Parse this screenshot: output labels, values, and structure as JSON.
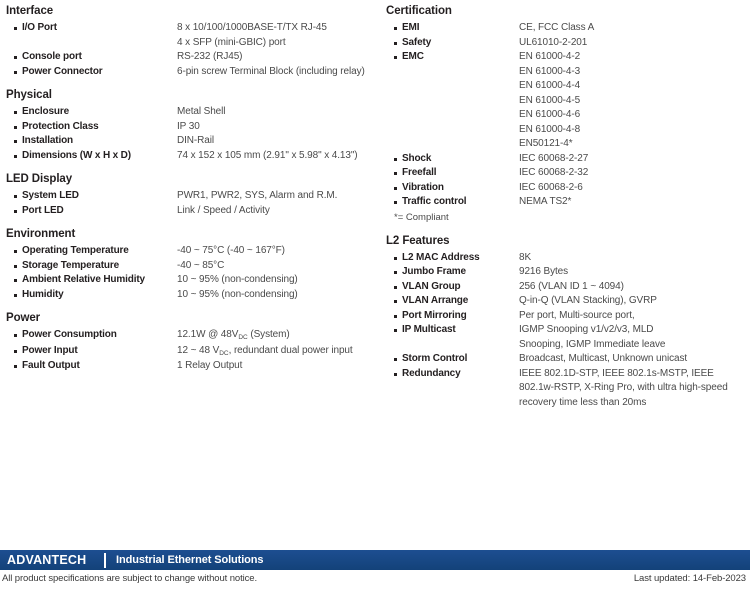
{
  "left_column": [
    {
      "title": "Interface",
      "rows": [
        {
          "label": "I/O Port",
          "values": [
            "8 x 10/100/1000BASE-T/TX RJ-45",
            "4 x SFP (mini-GBIC) port"
          ]
        },
        {
          "label": "Console port",
          "values": [
            "RS-232 (RJ45)"
          ]
        },
        {
          "label": "Power Connector",
          "values": [
            "6-pin screw Terminal Block (including relay)"
          ]
        }
      ]
    },
    {
      "title": "Physical",
      "rows": [
        {
          "label": "Enclosure",
          "values": [
            "Metal Shell"
          ]
        },
        {
          "label": "Protection Class",
          "values": [
            "IP 30"
          ]
        },
        {
          "label": "Installation",
          "values": [
            "DIN-Rail"
          ]
        },
        {
          "label": "Dimensions (W x H x D)",
          "values": [
            "74 x 152 x 105 mm (2.91\" x 5.98\" x 4.13\")"
          ]
        }
      ]
    },
    {
      "title": "LED Display",
      "rows": [
        {
          "label": "System LED",
          "values": [
            "PWR1, PWR2, SYS, Alarm and R.M."
          ]
        },
        {
          "label": "Port LED",
          "values": [
            "Link / Speed / Activity"
          ]
        }
      ]
    },
    {
      "title": "Environment",
      "rows": [
        {
          "label": "Operating Temperature",
          "values": [
            "-40 ~ 75°C (-40 ~ 167°F)"
          ]
        },
        {
          "label": "Storage Temperature",
          "values": [
            "-40 ~ 85°C"
          ]
        },
        {
          "label": "Ambient Relative Humidity",
          "values": [
            "10 ~ 95% (non-condensing)"
          ]
        },
        {
          "label": "Humidity",
          "values": [
            "10 ~ 95% (non-condensing)"
          ]
        }
      ]
    },
    {
      "title": "Power",
      "rows": [
        {
          "label": "Power Consumption",
          "values": [
            "12.1W @ 48V|DC| (System)"
          ]
        },
        {
          "label": "Power Input",
          "values": [
            "12 ~ 48 V|DC|, redundant dual power input"
          ]
        },
        {
          "label": "Fault Output",
          "values": [
            "1 Relay Output"
          ]
        }
      ]
    }
  ],
  "right_column": [
    {
      "title": "Certification",
      "rows": [
        {
          "label": "EMI",
          "values": [
            "CE, FCC Class A"
          ]
        },
        {
          "label": "Safety",
          "values": [
            "UL61010-2-201"
          ]
        },
        {
          "label": "EMC",
          "values": [
            "EN 61000-4-2",
            "EN 61000-4-3",
            "EN 61000-4-4",
            "EN 61000-4-5",
            "EN 61000-4-6",
            "EN 61000-4-8",
            "EN50121-4*"
          ]
        },
        {
          "label": "Shock",
          "values": [
            "IEC 60068-2-27"
          ]
        },
        {
          "label": "Freefall",
          "values": [
            "IEC 60068-2-32"
          ]
        },
        {
          "label": "Vibration",
          "values": [
            "IEC 60068-2-6"
          ]
        },
        {
          "label": "Traffic control",
          "values": [
            "NEMA TS2*"
          ]
        }
      ],
      "note": "*= Compliant"
    },
    {
      "title": "L2 Features",
      "rows": [
        {
          "label": "L2 MAC Address",
          "values": [
            "8K"
          ]
        },
        {
          "label": "Jumbo Frame",
          "values": [
            "9216 Bytes"
          ]
        },
        {
          "label": "VLAN Group",
          "values": [
            "256 (VLAN ID 1 ~ 4094)"
          ]
        },
        {
          "label": "VLAN Arrange",
          "values": [
            "Q-in-Q (VLAN Stacking), GVRP"
          ]
        },
        {
          "label": "Port Mirroring",
          "values": [
            "Per port, Multi-source port,"
          ]
        },
        {
          "label": "IP Multicast",
          "values": [
            "IGMP Snooping v1/v2/v3, MLD",
            "Snooping, IGMP Immediate leave"
          ]
        },
        {
          "label": "Storm Control",
          "values": [
            "Broadcast, Multicast, Unknown unicast"
          ]
        },
        {
          "label": "Redundancy",
          "values": [
            "IEEE 802.1D-STP, IEEE 802.1s-MSTP, IEEE",
            "802.1w-RSTP, X-Ring Pro, with ultra high-speed",
            "recovery time less than 20ms"
          ]
        }
      ]
    }
  ],
  "footer": {
    "logo": "ADVANTECH",
    "tagline": "Industrial Ethernet Solutions",
    "disclaimer": "All product specifications are subject to change without notice.",
    "last_updated": "Last updated: 14-Feb-2023",
    "bar_color": "#1b4b8f"
  }
}
